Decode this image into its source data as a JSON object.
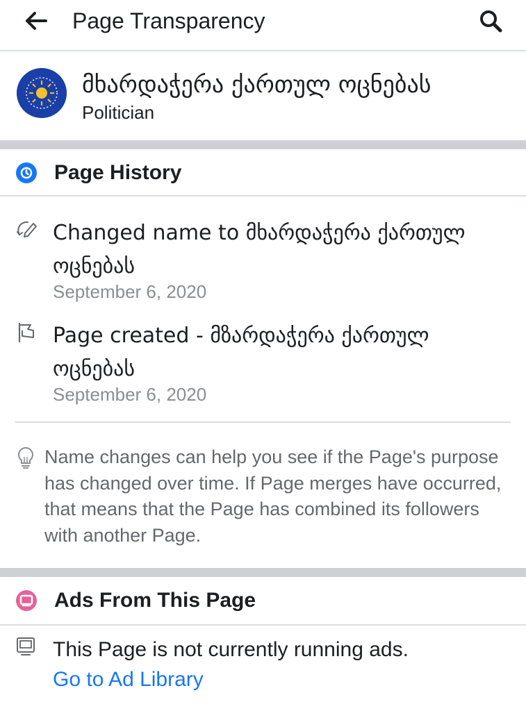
{
  "topbar": {
    "title": "Page Transparency",
    "back_icon": "arrow-left-icon",
    "search_icon": "search-icon"
  },
  "page": {
    "name": "მხარდაჭერა ქართულ ოცნებას",
    "category": "Politician",
    "avatar_color": "#1a3fa6"
  },
  "history": {
    "title": "Page History",
    "icon": "clock-icon",
    "icon_color": "#1877f2",
    "items": [
      {
        "icon": "edit-name-icon",
        "text": "Changed name to მხარდაჭერა ქართულ ოცნებას",
        "date": "September 6, 2020"
      },
      {
        "icon": "flag-icon",
        "text": "Page created - მზარდაჭერა ქართულ ოცნებას",
        "date": "September 6, 2020"
      }
    ],
    "tip": "Name changes can help you see if the Page's purpose has changed over time. If Page merges have occurred, that means that the Page has combined its followers with another Page.",
    "tip_icon": "lightbulb-icon"
  },
  "ads": {
    "title": "Ads From This Page",
    "icon": "ads-icon",
    "icon_color": "#e7609a",
    "status": "This Page is not currently running ads.",
    "status_icon": "screen-icon",
    "link": "Go to Ad Library",
    "link_color": "#1877f2"
  }
}
